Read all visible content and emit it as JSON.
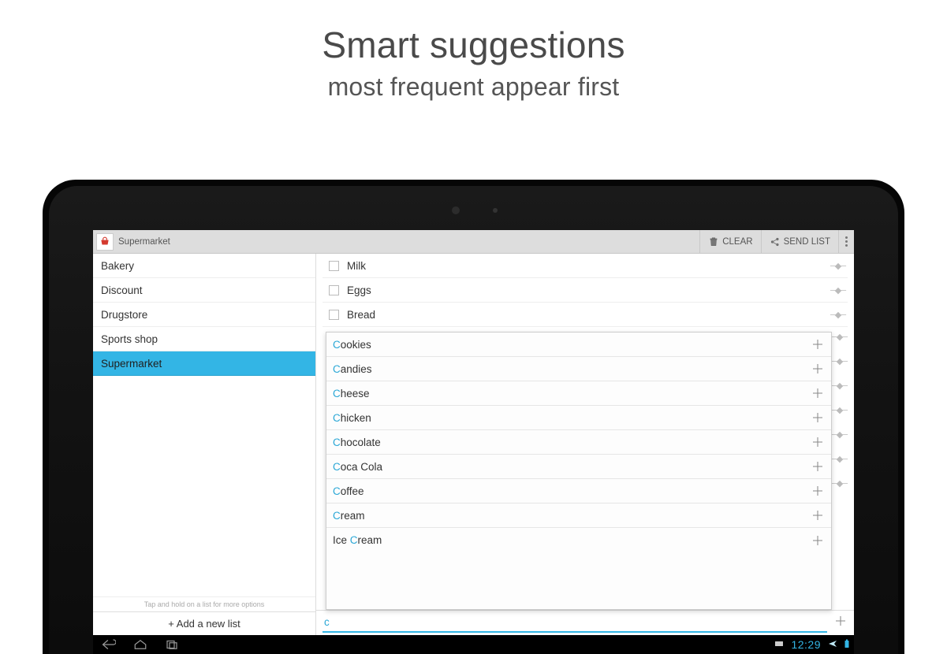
{
  "hero": {
    "title": "Smart suggestions",
    "subtitle": "most frequent appear first"
  },
  "actionbar": {
    "title": "Supermarket",
    "clear": "CLEAR",
    "send": "SEND LIST"
  },
  "sidebar": {
    "items": [
      "Bakery",
      "Discount",
      "Drugstore",
      "Sports shop",
      "Supermarket"
    ],
    "selectedIndex": 4,
    "hint": "Tap and hold on a list for more options",
    "add": "+ Add a new list"
  },
  "list": {
    "items": [
      "Milk",
      "Eggs",
      "Bread"
    ]
  },
  "suggestions": [
    {
      "pre": "C",
      "rest": "ookies"
    },
    {
      "pre": "C",
      "rest": "andies"
    },
    {
      "pre": "C",
      "rest": "heese"
    },
    {
      "pre": "C",
      "rest": "hicken"
    },
    {
      "pre": "C",
      "rest": "hocolate"
    },
    {
      "pre": "C",
      "rest": "oca Cola"
    },
    {
      "pre": "C",
      "rest": "offee"
    },
    {
      "pre": "C",
      "rest": "ream"
    },
    {
      "pre": "Ice C",
      "rest": "ream",
      "hlIndex": 4
    }
  ],
  "input": {
    "value": "c"
  },
  "system": {
    "time": "12:29"
  }
}
